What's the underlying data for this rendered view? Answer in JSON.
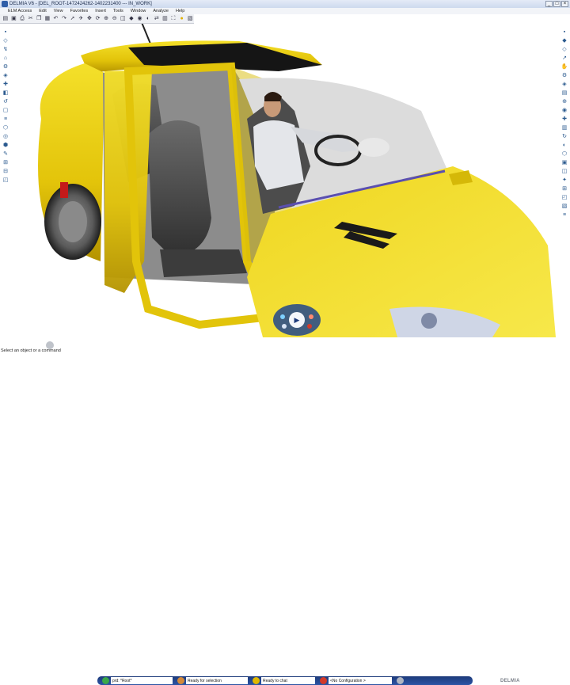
{
  "window": {
    "title": "DELMIA V6 - [DEL_ROOT-1472424262-1402231400 --- IN_WORK]",
    "controls": [
      "_",
      "□",
      "×"
    ]
  },
  "menubar": {
    "items": [
      "ELM Access",
      "Edit",
      "View",
      "Favorites",
      "Insert",
      "Tools",
      "Window",
      "Analyze",
      "Help"
    ]
  },
  "toolbar": {
    "icons": [
      "folder-icon",
      "save-icon",
      "print-icon",
      "cut-icon",
      "copy-icon",
      "paste-icon",
      "undo-icon",
      "redo-icon",
      "select-icon",
      "fly-icon",
      "pan-icon",
      "rotate-icon",
      "zoom-in-icon",
      "zoom-out-icon",
      "normal-view-icon",
      "cube-view-icon",
      "shading-icon",
      "hide-show-icon",
      "swap-icon",
      "render-icon",
      "fit-all-icon",
      "light-icon",
      "material-icon"
    ]
  },
  "compass": {
    "play_symbol": "▶"
  },
  "statusbar": {
    "prompt": "Select an object or a command",
    "product_field": "prd: *Root*",
    "selection_status": "Ready for selection",
    "chat_status": "Ready to chat",
    "configuration": "<No Configuration >",
    "logo": "DELMIA"
  },
  "colors": {
    "car_body": "#e8cf0a",
    "titlebar": "#cdd9ee",
    "cmdbar": "#1d3a7a",
    "accent_green": "#3aa84a",
    "accent_red": "#d23a2a"
  }
}
